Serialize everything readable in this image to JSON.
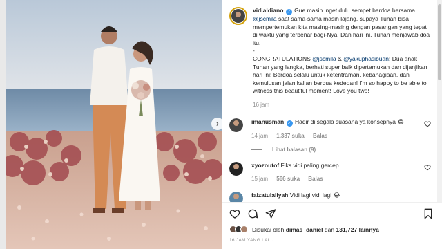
{
  "post": {
    "username": "vidialdiano",
    "caption_p1_a": "Gue masih inget dulu sempet berdoa bersama",
    "mention_1": "@jscmila",
    "caption_p1_b": "saat sama-sama masih lajang, supaya Tuhan bisa mempertemukan kita masing-masing dengan pasangan yang tepat di waktu yang terbenar bagi-Nya. Dan hari ini, Tuhan menjawab doa itu.",
    "caption_dash": "-",
    "caption_p2_a": "CONGRATULATIONS",
    "mention_2": "@jscmila",
    "amp": "&",
    "mention_3": "@yakuphasibuan",
    "caption_p2_b": "! Dua anak Tuhan yang langka, berhati super baik dipertemukan dan dijanjikan hari ini! Berdoa selalu untuk ketentraman, kebahagiaan, dan kemulusan jalan kalian berdua kedepan! I'm so happy to be able to witness this beautiful moment! Love you two!",
    "time": "16 jam"
  },
  "comments": [
    {
      "username": "imanusman",
      "text": "Hadir di segala suasana ya konsepnya 😂",
      "time": "14 jam",
      "likes": "1.387 suka",
      "reply": "Balas",
      "view_replies": "Lihat balasan (9)"
    },
    {
      "username": "xyozoutof",
      "text": "Fiks vidi paling gercep.",
      "time": "15 jam",
      "likes": "566 suka",
      "reply": "Balas"
    },
    {
      "username": "faizatulaliyah",
      "text": "Vidi lagi vidi lagi 😂"
    }
  ],
  "likes": {
    "prefix": "Disukai oleh",
    "user": "dimas_daniel",
    "conj": "dan",
    "count": "131,727",
    "suffix": "lainnya"
  },
  "post_time": "16 JAM YANG LALU",
  "icons": [
    "heart-icon",
    "comment-icon",
    "share-icon",
    "bookmark-icon",
    "next-arrow-icon",
    "verified-icon"
  ],
  "colors": {
    "verified": "#3897f0",
    "mention": "#00376b",
    "muted": "#8e8e8e",
    "story_ring": "#d4a20b"
  }
}
